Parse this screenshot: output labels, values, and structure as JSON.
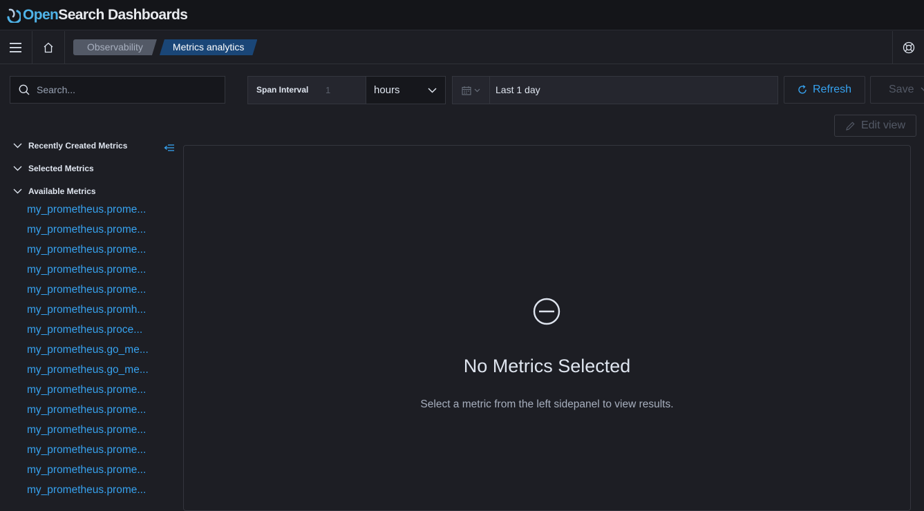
{
  "header": {
    "logo_open": "Open",
    "logo_rest": "Search Dashboards"
  },
  "nav": {
    "menu_icon": "hamburger-icon",
    "home_icon": "home-icon",
    "breadcrumbs": [
      "Observability",
      "Metrics analytics"
    ],
    "help_icon": "help-icon"
  },
  "toolbar": {
    "search_placeholder": "Search...",
    "span_interval_label": "Span Interval",
    "span_interval_value": "1",
    "span_unit": "hours",
    "date_range": "Last 1 day",
    "refresh_label": "Refresh",
    "save_label": "Save",
    "edit_view_label": "Edit view"
  },
  "sidebar": {
    "sections": [
      "Recently Created Metrics",
      "Selected Metrics",
      "Available Metrics"
    ],
    "available_metrics": [
      "my_prometheus.prome...",
      "my_prometheus.prome...",
      "my_prometheus.prome...",
      "my_prometheus.prome...",
      "my_prometheus.prome...",
      "my_prometheus.promh...",
      "my_prometheus.proce...",
      "my_prometheus.go_me...",
      "my_prometheus.go_me...",
      "my_prometheus.prome...",
      "my_prometheus.prome...",
      "my_prometheus.prome...",
      "my_prometheus.prome...",
      "my_prometheus.prome...",
      "my_prometheus.prome..."
    ]
  },
  "main": {
    "empty_title": "No Metrics Selected",
    "empty_body": "Select a metric from the left sidepanel to view results."
  },
  "colors": {
    "accent": "#36a2ef",
    "background": "#1d1e24",
    "header": "#141519",
    "breadcrumb_active": "#1a4677"
  }
}
